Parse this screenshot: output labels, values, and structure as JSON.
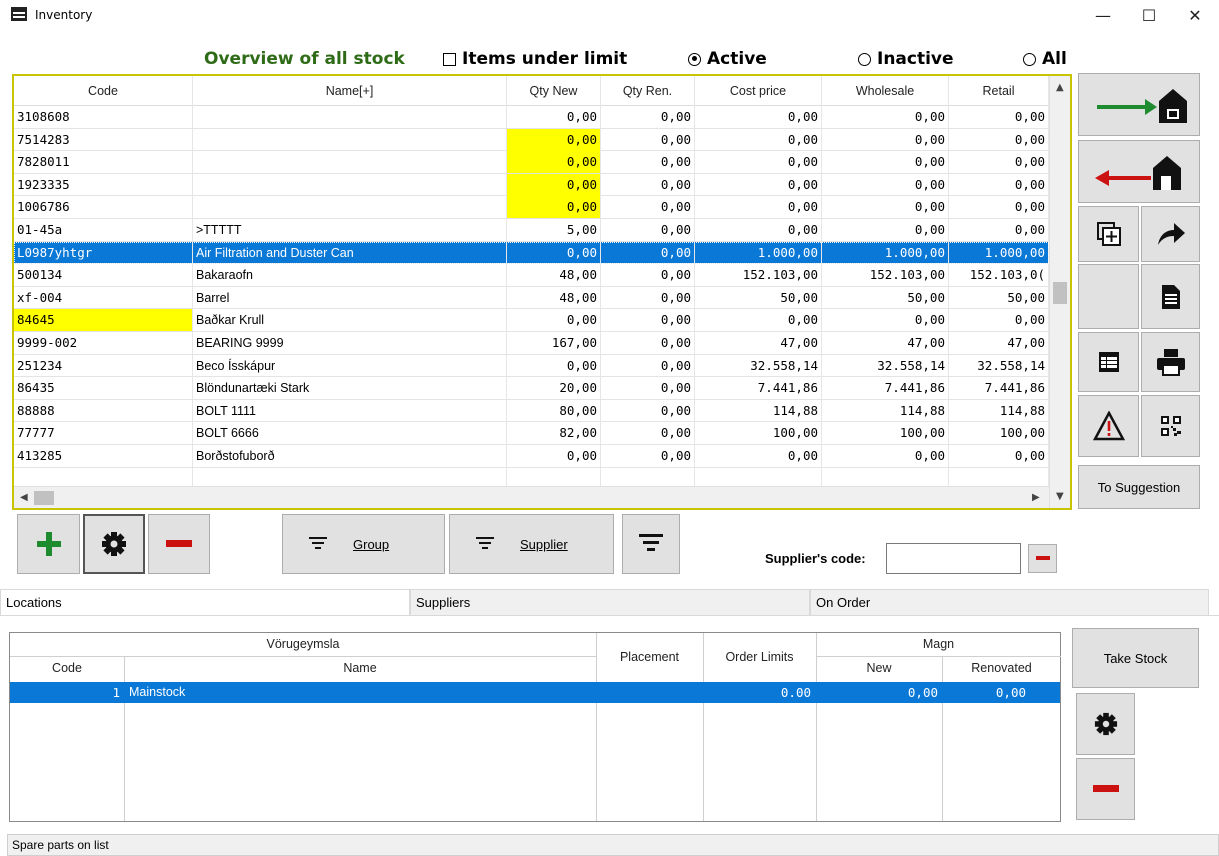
{
  "window": {
    "title": "Inventory",
    "icon": "inventory-app-icon",
    "controls": {
      "minimize": "—",
      "maximize": "☐",
      "close": "✕"
    }
  },
  "header": {
    "title": "Overview of all stock",
    "items_under_limit": {
      "label": "Items under limit",
      "checked": false
    },
    "filter_options": [
      {
        "label": "Active",
        "selected": true
      },
      {
        "label": "Inactive",
        "selected": false
      },
      {
        "label": "All",
        "selected": false
      }
    ]
  },
  "grid": {
    "columns": [
      "Code",
      "Name[+]",
      "Qty New",
      "Qty Ren.",
      "Cost price",
      "Wholesale",
      "Retail"
    ],
    "rows": [
      {
        "code": "3108608",
        "name": "",
        "qty_new": "0,00",
        "qty_ren": "0,00",
        "cost": "0,00",
        "wholesale": "0,00",
        "retail": "0,00",
        "hl_qty": false,
        "hl_code": false
      },
      {
        "code": "7514283",
        "name": "",
        "qty_new": "0,00",
        "qty_ren": "0,00",
        "cost": "0,00",
        "wholesale": "0,00",
        "retail": "0,00",
        "hl_qty": true,
        "hl_code": false
      },
      {
        "code": "7828011",
        "name": "",
        "qty_new": "0,00",
        "qty_ren": "0,00",
        "cost": "0,00",
        "wholesale": "0,00",
        "retail": "0,00",
        "hl_qty": true,
        "hl_code": false
      },
      {
        "code": "1923335",
        "name": "",
        "qty_new": "0,00",
        "qty_ren": "0,00",
        "cost": "0,00",
        "wholesale": "0,00",
        "retail": "0,00",
        "hl_qty": true,
        "hl_code": false
      },
      {
        "code": "1006786",
        "name": "",
        "qty_new": "0,00",
        "qty_ren": "0,00",
        "cost": "0,00",
        "wholesale": "0,00",
        "retail": "0,00",
        "hl_qty": true,
        "hl_code": false
      },
      {
        "code": "01-45a",
        "name": ">TTTTT",
        "qty_new": "5,00",
        "qty_ren": "0,00",
        "cost": "0,00",
        "wholesale": "0,00",
        "retail": "0,00",
        "hl_qty": false,
        "hl_code": false
      },
      {
        "code": "L0987yhtgr",
        "name": "Air Filtration and Duster Can",
        "qty_new": "0,00",
        "qty_ren": "0,00",
        "cost": "1.000,00",
        "wholesale": "1.000,00",
        "retail": "1.000,00",
        "hl_qty": false,
        "hl_code": false,
        "selected": true
      },
      {
        "code": "500134",
        "name": "Bakaraofn",
        "qty_new": "48,00",
        "qty_ren": "0,00",
        "cost": "152.103,00",
        "wholesale": "152.103,00",
        "retail": "152.103,0(",
        "hl_qty": false,
        "hl_code": false
      },
      {
        "code": "xf-004",
        "name": "Barrel",
        "qty_new": "48,00",
        "qty_ren": "0,00",
        "cost": "50,00",
        "wholesale": "50,00",
        "retail": "50,00",
        "hl_qty": false,
        "hl_code": false
      },
      {
        "code": "84645",
        "name": "Baðkar Krull",
        "qty_new": "0,00",
        "qty_ren": "0,00",
        "cost": "0,00",
        "wholesale": "0,00",
        "retail": "0,00",
        "hl_qty": false,
        "hl_code": true
      },
      {
        "code": "9999-002",
        "name": "BEARING 9999",
        "qty_new": "167,00",
        "qty_ren": "0,00",
        "cost": "47,00",
        "wholesale": "47,00",
        "retail": "47,00",
        "hl_qty": false,
        "hl_code": false
      },
      {
        "code": "251234",
        "name": "Beco Ísskápur",
        "qty_new": "0,00",
        "qty_ren": "0,00",
        "cost": "32.558,14",
        "wholesale": "32.558,14",
        "retail": "32.558,14",
        "hl_qty": false,
        "hl_code": false
      },
      {
        "code": "86435",
        "name": "Blöndunartæki Stark",
        "qty_new": "20,00",
        "qty_ren": "0,00",
        "cost": "7.441,86",
        "wholesale": "7.441,86",
        "retail": "7.441,86",
        "hl_qty": false,
        "hl_code": false
      },
      {
        "code": "88888",
        "name": "BOLT 1111",
        "qty_new": "80,00",
        "qty_ren": "0,00",
        "cost": "114,88",
        "wholesale": "114,88",
        "retail": "114,88",
        "hl_qty": false,
        "hl_code": false
      },
      {
        "code": "77777",
        "name": "BOLT 6666",
        "qty_new": "82,00",
        "qty_ren": "0,00",
        "cost": "100,00",
        "wholesale": "100,00",
        "retail": "100,00",
        "hl_qty": false,
        "hl_code": false
      },
      {
        "code": "413285",
        "name": "Borðstofuborð",
        "qty_new": "0,00",
        "qty_ren": "0,00",
        "cost": "0,00",
        "wholesale": "0,00",
        "retail": "0,00",
        "hl_qty": false,
        "hl_code": false
      },
      {
        "code": "",
        "name": "",
        "qty_new": "",
        "qty_ren": "",
        "cost": "",
        "wholesale": "",
        "retail": "",
        "hl_qty": false,
        "hl_code": false
      }
    ]
  },
  "toolbar": {
    "to_suggestion": "To Suggestion",
    "icons": [
      "stock-in-icon",
      "stock-out-icon",
      "copy-add-icon",
      "forward-icon",
      "document-icon",
      "spreadsheet-icon",
      "printer-icon",
      "warning-icon",
      "qr-code-icon"
    ]
  },
  "actions": {
    "group": "Group",
    "supplier": "Supplier",
    "suppliers_code_label": "Supplier's code:",
    "suppliers_code_value": ""
  },
  "tabs": [
    {
      "label": "Locations",
      "active": true
    },
    {
      "label": "Suppliers",
      "active": false
    },
    {
      "label": "On Order",
      "active": false
    }
  ],
  "locations": {
    "group_header": "Vörugeymsla",
    "magn_header": "Magn",
    "columns": {
      "code": "Code",
      "name": "Name",
      "placement": "Placement",
      "order_limits": "Order Limits",
      "new": "New",
      "renovated": "Renovated"
    },
    "rows": [
      {
        "code": "1",
        "name": "Mainstock",
        "placement": "",
        "order_limits": "0.00",
        "new": "0,00",
        "renovated": "0,00"
      }
    ],
    "take_stock": "Take Stock"
  },
  "status": "Spare parts on list",
  "colors": {
    "accent_green": "#2e6b17",
    "selection": "#0a78d7",
    "highlight": "#ffff00",
    "frame": "#c8c400",
    "red": "#cc1111"
  }
}
